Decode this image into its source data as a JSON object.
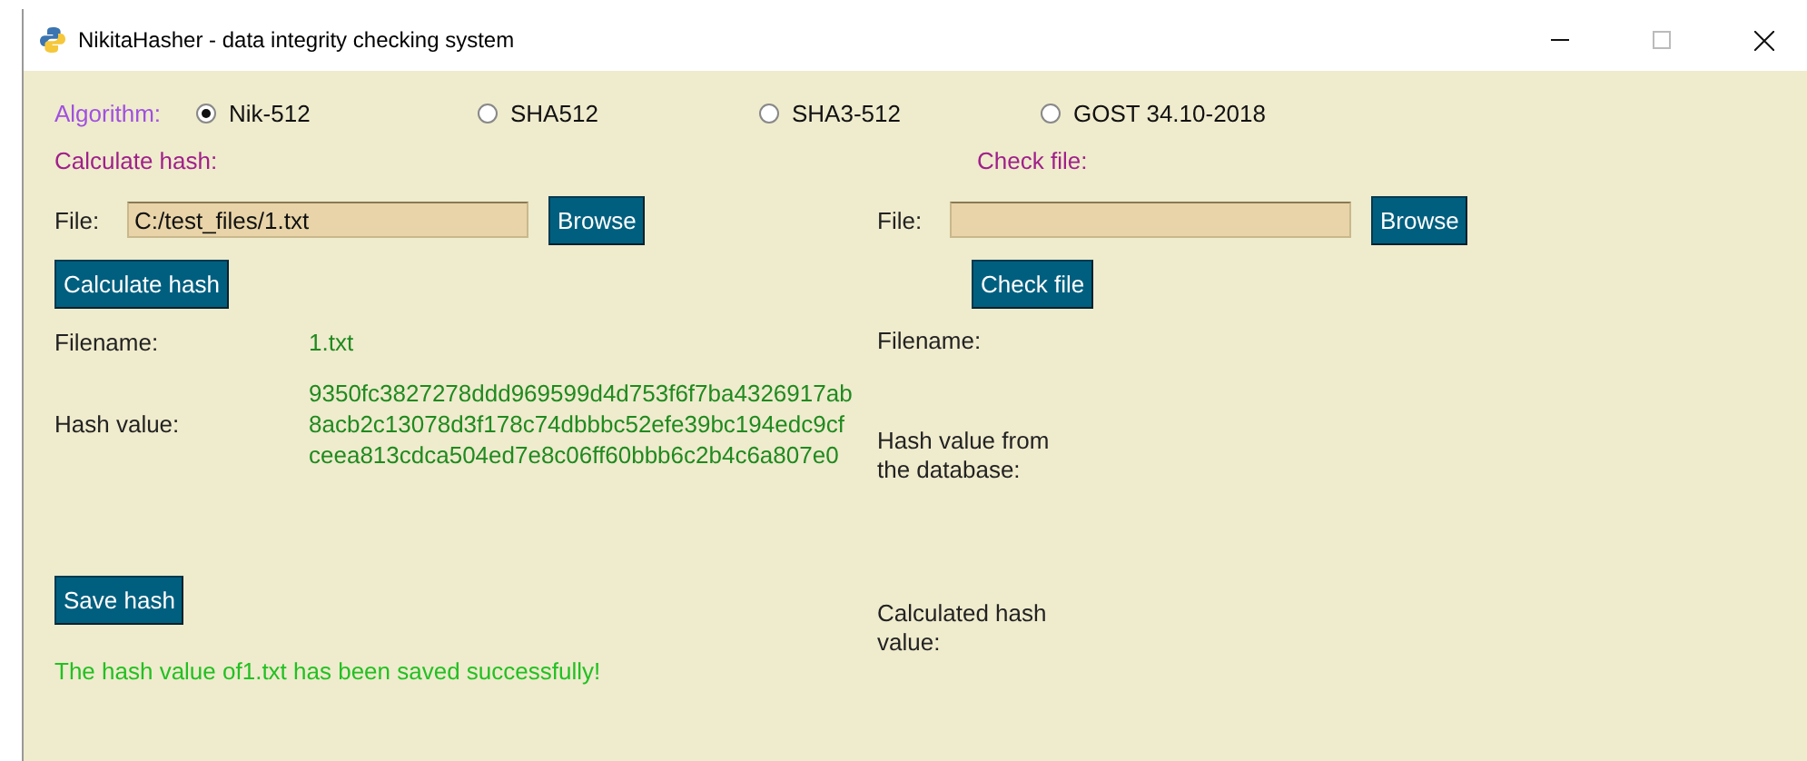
{
  "window": {
    "title": "NikitaHasher - data integrity checking system"
  },
  "algorithm": {
    "label": "Algorithm:",
    "options": [
      {
        "label": "Nik-512",
        "selected": true
      },
      {
        "label": "SHA512",
        "selected": false
      },
      {
        "label": "SHA3-512",
        "selected": false
      },
      {
        "label": "GOST 34.10-2018",
        "selected": false
      }
    ]
  },
  "calculate": {
    "heading": "Calculate hash:",
    "file_label": "File:",
    "file_value": "C:/test_files/1.txt",
    "browse": "Browse",
    "action": "Calculate hash",
    "filename_label": "Filename:",
    "filename_value": "1.txt",
    "hash_label": "Hash value:",
    "hash_lines": [
      "9350fc3827278ddd969599d4d753f6f7ba4326917ab",
      "8acb2c13078d3f178c74dbbbc52efe39bc194edc9cf",
      "ceea813cdca504ed7e8c06ff60bbb6c2b4c6a807e0"
    ],
    "save": "Save hash",
    "message": "The hash value of1.txt has been saved successfully!"
  },
  "check": {
    "heading": "Check file:",
    "file_label": "File:",
    "browse": "Browse",
    "action": "Check file",
    "filename_label": "Filename:",
    "db_hash_label": "Hash value from the database:",
    "calc_hash_label": "Calculated hash value:"
  }
}
